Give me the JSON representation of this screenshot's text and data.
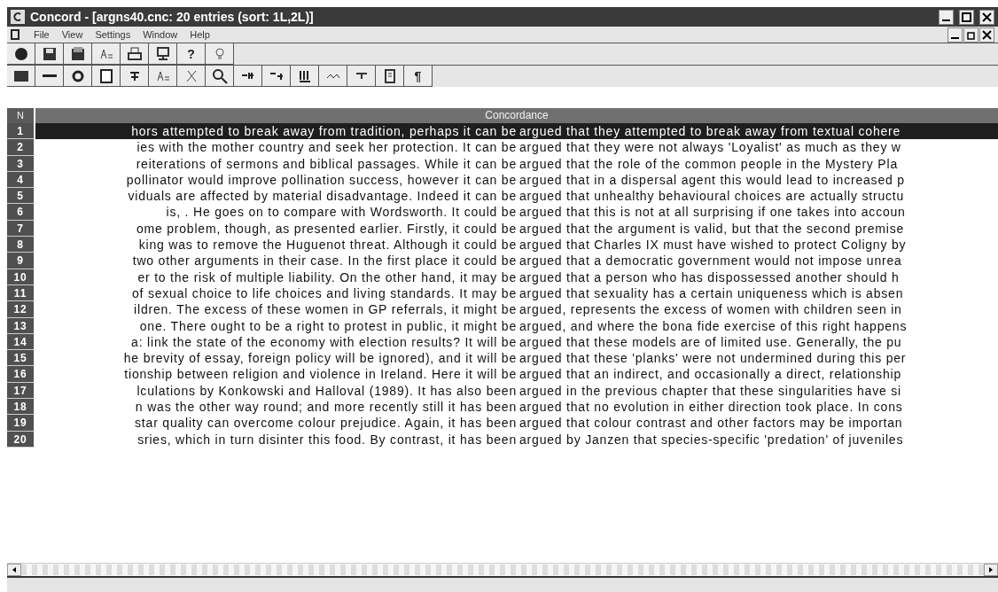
{
  "window": {
    "title": "Concord - [argns40.cnc: 20 entries (sort: 1L,2L)]"
  },
  "menu": [
    "File",
    "View",
    "Settings",
    "Window",
    "Help"
  ],
  "toolbar_1": [
    {
      "kind": "record"
    },
    {
      "kind": "save"
    },
    {
      "kind": "save-all"
    },
    {
      "kind": "text-a"
    },
    {
      "kind": "print"
    },
    {
      "kind": "preview"
    },
    {
      "kind": "glyph",
      "label": "?"
    },
    {
      "kind": "bulb"
    }
  ],
  "toolbar_2": [
    {
      "kind": "block"
    },
    {
      "kind": "line"
    },
    {
      "kind": "refresh"
    },
    {
      "kind": "window"
    },
    {
      "kind": "sort"
    },
    {
      "kind": "text-a"
    },
    {
      "kind": "cut"
    },
    {
      "kind": "search"
    },
    {
      "kind": "left"
    },
    {
      "kind": "right"
    },
    {
      "kind": "columns"
    },
    {
      "kind": "wave"
    },
    {
      "kind": "pin"
    },
    {
      "kind": "page"
    },
    {
      "kind": "glyph",
      "label": "¶"
    }
  ],
  "table": {
    "columns": [
      "N",
      "Concordance"
    ],
    "rows": [
      {
        "n": "1",
        "left": "hors attempted to break away from tradition, perhaps it can be",
        "right": "argued that they attempted to break away from textual cohere",
        "selected": true
      },
      {
        "n": "2",
        "left": "ies with the mother country and seek her protection.  It can be",
        "right": "argued that they were not always 'Loyalist' as much as they w",
        "selected": false
      },
      {
        "n": "3",
        "left": "reiterations of sermons and biblical passages. While it can be",
        "right": "argued that the role of the common people in the Mystery Pla",
        "selected": false
      },
      {
        "n": "4",
        "left": "pollinator would improve pollination success, however it can be",
        "right": "argued that in a dispersal agent this would lead to increased p",
        "selected": false
      },
      {
        "n": "5",
        "left": "viduals are affected by material disadvantage. Indeed it can be",
        "right": "argued that unhealthy behavioural choices are actually structu",
        "selected": false
      },
      {
        "n": "6",
        "left": "is,     . He goes on to compare      with Wordsworth.  It could be",
        "right": "argued that this is not at all surprising if one takes into accoun",
        "selected": false
      },
      {
        "n": "7",
        "left": "ome problem, though, as presented earlier.  Firstly, it could be",
        "right": "argued that the argument is valid, but that the second premise",
        "selected": false
      },
      {
        "n": "8",
        "left": "king was to remove the Huguenot threat. Although it could be",
        "right": "argued that Charles IX must have wished to protect Coligny by",
        "selected": false
      },
      {
        "n": "9",
        "left": "two other arguments in their case.  In the first place it could be",
        "right": "argued that a democratic government would not impose unrea",
        "selected": false
      },
      {
        "n": "10",
        "left": "er to the risk of multiple liability.  On the other hand, it may be",
        "right": "argued that a person who has dispossessed another should h",
        "selected": false
      },
      {
        "n": "11",
        "left": "of sexual choice to life choices and living standards.  It may be",
        "right": "argued that sexuality has a certain uniqueness which is absen",
        "selected": false
      },
      {
        "n": "12",
        "left": "ildren.  The excess of these women in GP referrals, it might be",
        "right": "argued, represents the excess of women with children seen in",
        "selected": false
      },
      {
        "n": "13",
        "left": "one.  There ought to be a right to protest in public, it might be",
        "right": "argued, and where the bona fide exercise of this right happens",
        "selected": false
      },
      {
        "n": "14",
        "left": "a: link the state of the economy with election results? It will be",
        "right": "argued that these models are of limited use. Generally, the pu",
        "selected": false
      },
      {
        "n": "15",
        "left": "he brevity of essay, foreign policy will be ignored), and it will be",
        "right": "argued that these 'planks' were not undermined during this per",
        "selected": false
      },
      {
        "n": "16",
        "left": "tionship between religion and violence in Ireland. Here it will be",
        "right": "argued that an indirect, and occasionally a direct, relationship",
        "selected": false
      },
      {
        "n": "17",
        "left": "lculations by Konkowski and Halloval (1989). It has also been",
        "right": "argued in the previous chapter that these singularities have si",
        "selected": false
      },
      {
        "n": "18",
        "left": "n was the other way round; and more recently still it has been",
        "right": "argued that no evolution in either direction took place. In cons",
        "selected": false
      },
      {
        "n": "19",
        "left": "star quality can overcome colour prejudice.  Again, it has been",
        "right": "argued that colour contrast and other factors may be importan",
        "selected": false
      },
      {
        "n": "20",
        "left": "sries, which in turn disinter this food.  By contrast, it has been",
        "right": "argued by Janzen that species-specific 'predation' of juveniles",
        "selected": false
      }
    ]
  }
}
